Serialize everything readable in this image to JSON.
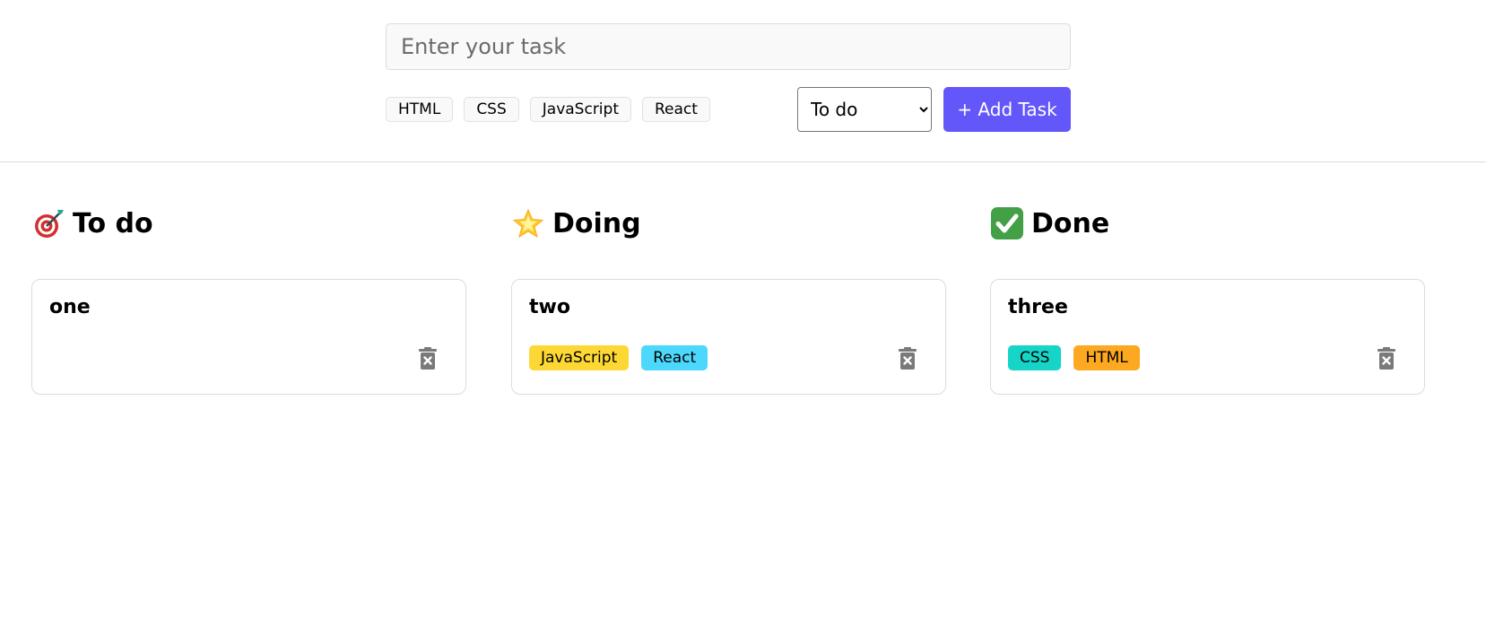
{
  "form": {
    "task_placeholder": "Enter your task",
    "tags": [
      "HTML",
      "CSS",
      "JavaScript",
      "React"
    ],
    "status_selected": "To do",
    "add_button_label": "+ Add Task"
  },
  "columns": [
    {
      "title": "To do",
      "icon": "target-dart-icon",
      "cards": [
        {
          "title": "one",
          "tags": []
        }
      ]
    },
    {
      "title": "Doing",
      "icon": "glowing-star-icon",
      "cards": [
        {
          "title": "two",
          "tags": [
            {
              "label": "JavaScript",
              "color": "#fdd835"
            },
            {
              "label": "React",
              "color": "#4cd8fc"
            }
          ]
        }
      ]
    },
    {
      "title": "Done",
      "icon": "check-mark-button-icon",
      "cards": [
        {
          "title": "three",
          "tags": [
            {
              "label": "CSS",
              "color": "#15d4c8"
            },
            {
              "label": "HTML",
              "color": "#fda821"
            }
          ]
        }
      ]
    }
  ],
  "colors": {
    "accent": "#6457f9",
    "delete_icon": "#7a7a7a"
  }
}
